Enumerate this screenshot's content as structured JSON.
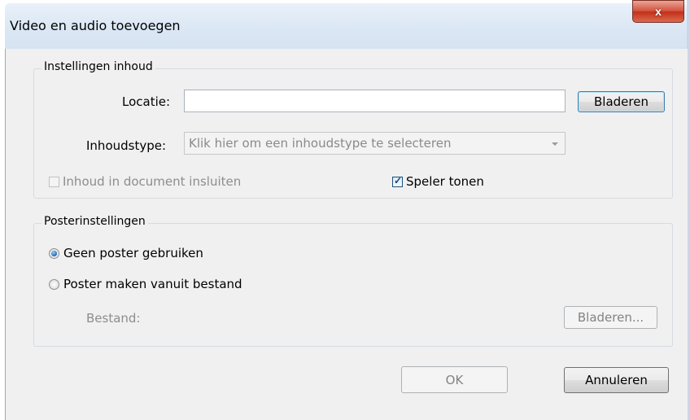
{
  "window": {
    "title": "Video en audio toevoegen",
    "close_label": "x"
  },
  "content_settings": {
    "legend": "Instellingen inhoud",
    "location_label": "Locatie:",
    "location_value": "",
    "browse_label": "Bladeren",
    "content_type_label": "Inhoudstype:",
    "content_type_placeholder": "Klik hier om een inhoudstype te selecteren",
    "embed_label": "Inhoud in document insluiten",
    "embed_checked": false,
    "embed_enabled": false,
    "show_player_label": "Speler tonen",
    "show_player_checked": true
  },
  "poster_settings": {
    "legend": "Posterinstellingen",
    "option_none_label": "Geen poster gebruiken",
    "option_file_label": "Poster maken vanuit bestand",
    "selected_option": "none",
    "file_label": "Bestand:",
    "browse_label": "Bladeren..."
  },
  "footer": {
    "ok_label": "OK",
    "cancel_label": "Annuleren"
  },
  "colors": {
    "dialog_background": "#f0f0f0",
    "titlebar": "#dbe7f4",
    "close_button": "#c32f18",
    "focus_border": "#3c7fb1",
    "disabled_text": "#8d8d8d"
  }
}
